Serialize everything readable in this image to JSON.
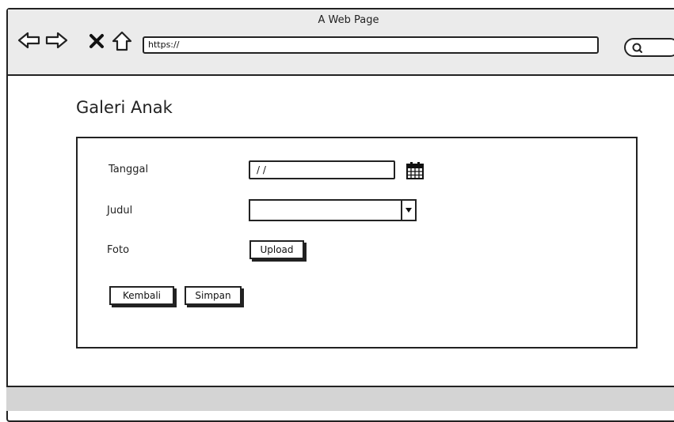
{
  "window": {
    "title": "A Web Page"
  },
  "toolbar": {
    "url": "https://"
  },
  "icons": {
    "back": "arrow-left-outline-icon",
    "forward": "arrow-right-outline-icon",
    "stop": "close-icon",
    "home": "home-icon",
    "search": "search-icon",
    "calendar": "calendar-icon",
    "dropdown": "chevron-down-icon"
  },
  "page": {
    "title": "Galeri Anak",
    "form": {
      "tanggal_label": "Tanggal",
      "tanggal_value": "/ /",
      "judul_label": "Judul",
      "judul_value": "",
      "foto_label": "Foto",
      "upload_label": "Upload",
      "back_label": "Kembali",
      "save_label": "Simpan"
    }
  }
}
